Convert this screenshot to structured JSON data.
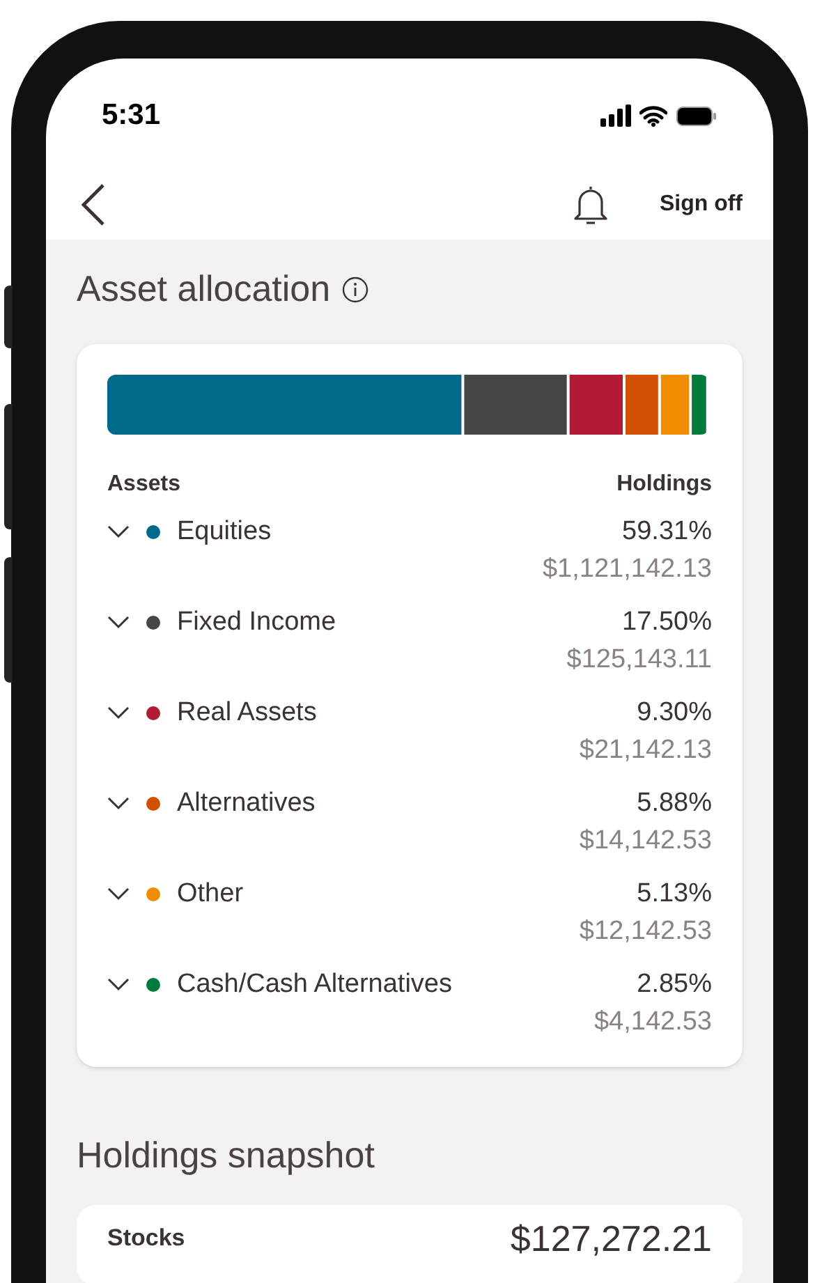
{
  "status_bar": {
    "time": "5:31"
  },
  "header": {
    "sign_off": "Sign off"
  },
  "asset_allocation": {
    "title": "Asset allocation",
    "columns": [
      "Assets",
      "Holdings"
    ],
    "assets": [
      {
        "name": "Equities",
        "percent": "59.31%",
        "amount": "$1,121,142.13",
        "color": "#00698c",
        "expanded": false
      },
      {
        "name": "Fixed Income",
        "percent": "17.50%",
        "amount": "$125,143.11",
        "color": "#46464a",
        "expanded": false
      },
      {
        "name": "Real Assets",
        "percent": "9.30%",
        "amount": "$21,142.13",
        "color": "#b31a35",
        "expanded": false
      },
      {
        "name": "Alternatives",
        "percent": "5.88%",
        "amount": "$14,142.53",
        "color": "#d04f00",
        "expanded": false
      },
      {
        "name": "Other",
        "percent": "5.13%",
        "amount": "$12,142.53",
        "color": "#f08c00",
        "expanded": false
      },
      {
        "name": "Cash/Cash Alternatives",
        "percent": "2.85%",
        "amount": "$4,142.53",
        "color": "#007a3d",
        "expanded": false
      }
    ]
  },
  "holdings_snapshot": {
    "title": "Holdings snapshot",
    "rows": [
      {
        "label": "Stocks",
        "value": "$127,272.21"
      }
    ]
  }
}
